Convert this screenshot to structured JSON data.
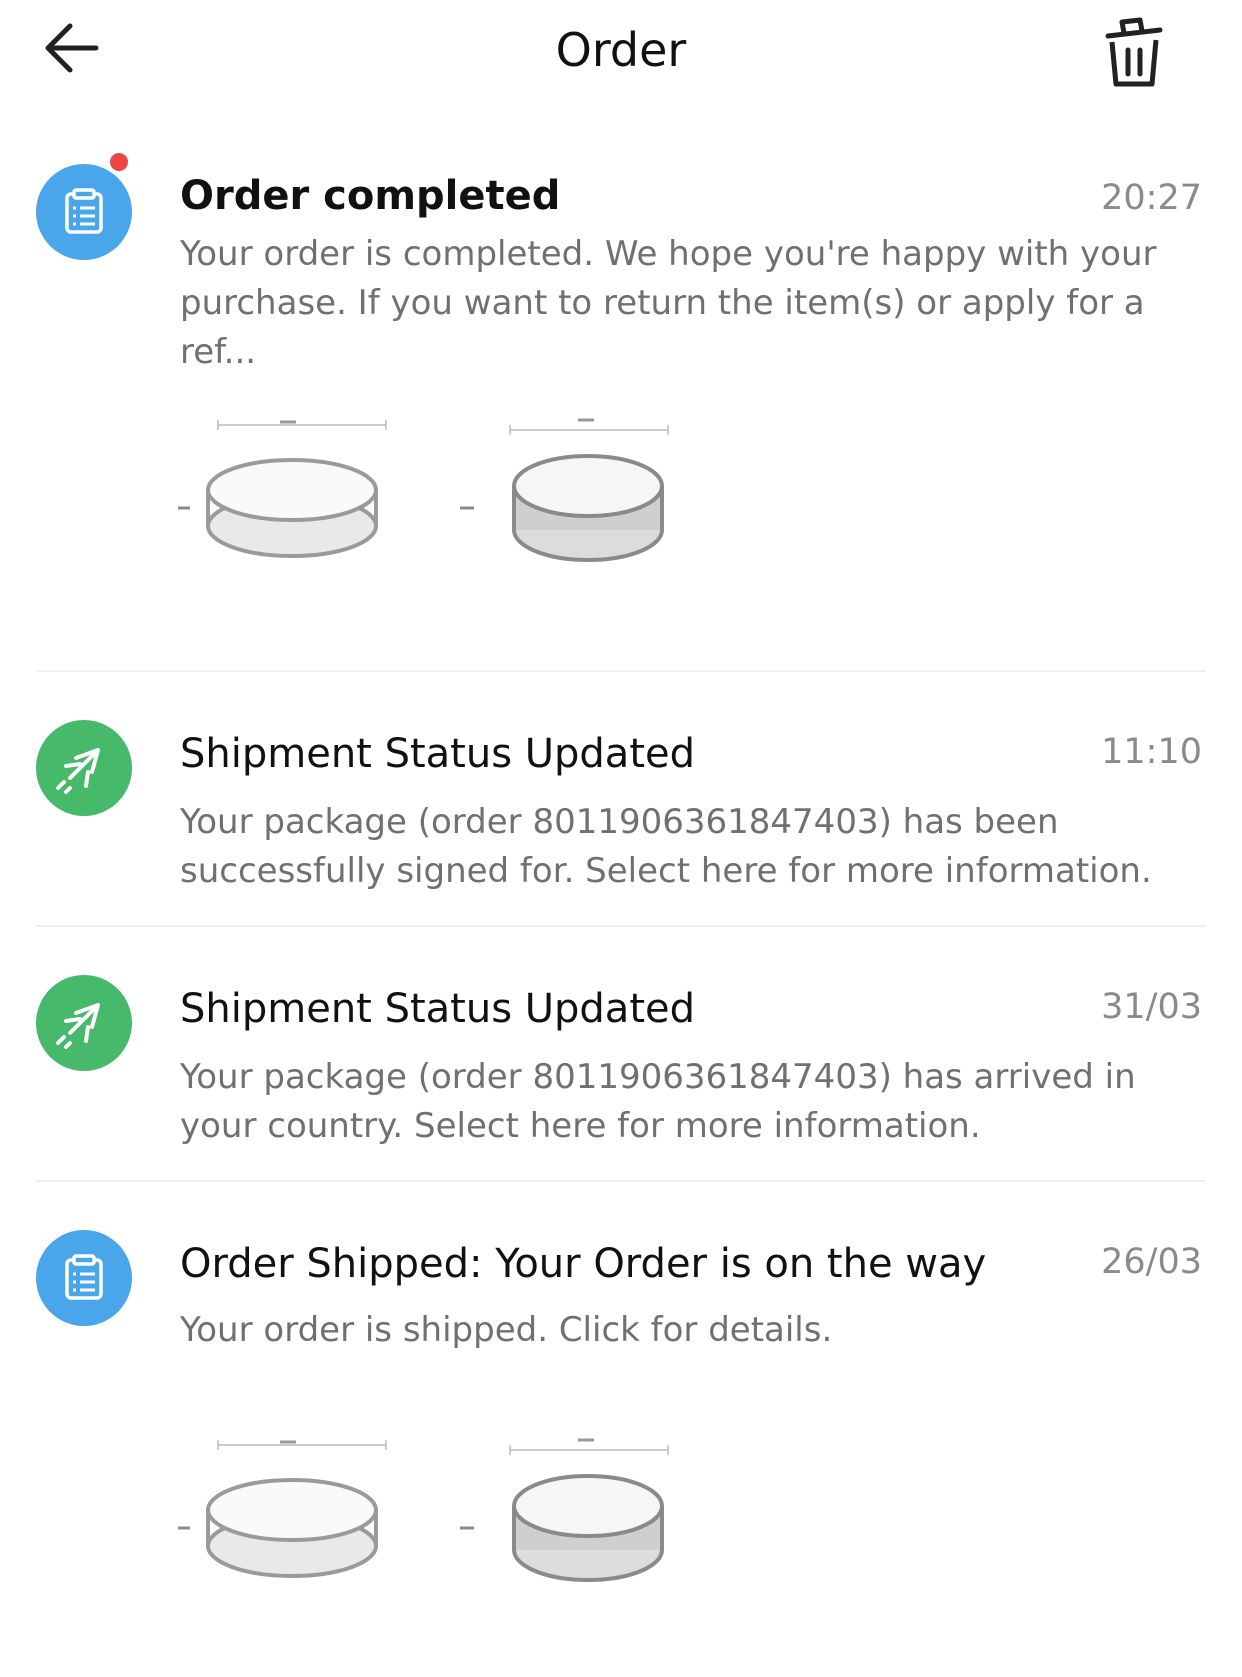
{
  "header": {
    "title": "Order",
    "back_icon": "arrow-left-icon",
    "delete_icon": "trash-icon"
  },
  "colors": {
    "blue": "#4aa6ea",
    "green": "#47b96b",
    "unread": "#ef4444"
  },
  "messages": [
    {
      "title": "Order completed",
      "time": "20:27",
      "body": "Your order is completed. We hope you're happy with your purchase. If you want to return the item(s) or apply for a ref...",
      "icon": "clipboard-icon",
      "unread": true
    },
    {
      "title": "Shipment Status Updated",
      "time": "11:10",
      "body": "Your package (order 8011906361847403) has been successfully signed for. Select here for more information.",
      "icon": "airplane-icon"
    },
    {
      "title": "Shipment Status Updated",
      "time": "31/03",
      "body": "Your package (order 8011906361847403) has arrived in your country. Select here for more information.",
      "icon": "airplane-icon"
    },
    {
      "title": "Order Shipped: Your Order is on the way",
      "time": "26/03",
      "body": "Your order is shipped. Click for details.",
      "icon": "clipboard-icon"
    }
  ]
}
